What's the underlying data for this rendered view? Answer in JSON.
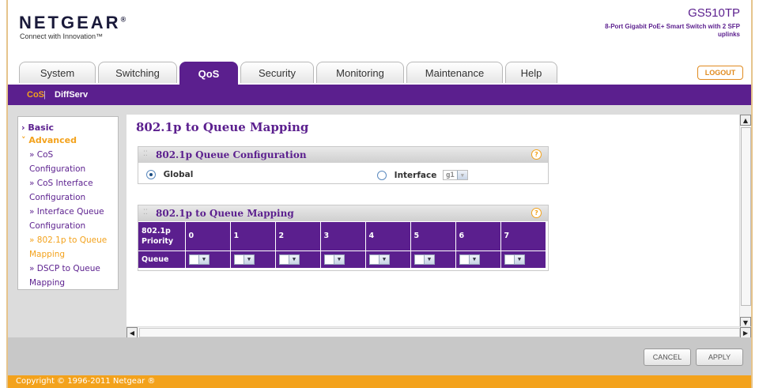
{
  "brand": {
    "logo_text": "NETGEAR",
    "logo_mark": "®",
    "tagline": "Connect with Innovation™"
  },
  "device": {
    "model": "GS510TP",
    "description": "8-Port Gigabit PoE+ Smart Switch with 2 SFP uplinks"
  },
  "tabs": [
    {
      "label": "System"
    },
    {
      "label": "Switching"
    },
    {
      "label": "QoS",
      "active": true
    },
    {
      "label": "Security"
    },
    {
      "label": "Monitoring"
    },
    {
      "label": "Maintenance"
    },
    {
      "label": "Help"
    }
  ],
  "logout_label": "LOGOUT",
  "subnav": {
    "cos": "CoS",
    "separator": "|",
    "diffserv": "DiffServ"
  },
  "sidebar": {
    "basic": "› Basic",
    "advanced": "˅ Advanced",
    "items": [
      {
        "label": "» CoS"
      },
      {
        "label": "Configuration"
      },
      {
        "label": "» CoS Interface"
      },
      {
        "label": "Configuration"
      },
      {
        "label": "» Interface Queue"
      },
      {
        "label": "Configuration"
      },
      {
        "label": "» 802.1p to Queue"
      },
      {
        "label": "Mapping"
      },
      {
        "label": "» DSCP to Queue"
      },
      {
        "label": "Mapping"
      }
    ]
  },
  "page_title": "802.1p to Queue Mapping",
  "config_panel": {
    "title": "802.1p Queue Configuration",
    "global_label": "Global",
    "interface_label": "Interface",
    "interface_value": "g1",
    "selected": "Global"
  },
  "mapping_panel": {
    "title": "802.1p to Queue Mapping",
    "priority_header_1": "802.1p",
    "priority_header_2": "Priority",
    "queue_header": "Queue",
    "priorities": [
      "0",
      "1",
      "2",
      "3",
      "4",
      "5",
      "6",
      "7"
    ],
    "queues": [
      "1",
      "0",
      "0",
      "1",
      "2",
      "2",
      "3",
      "3"
    ]
  },
  "buttons": {
    "cancel": "CANCEL",
    "apply": "APPLY"
  },
  "copyright": "Copyright © 1996-2011 Netgear ®",
  "colors": {
    "brand_purple": "#5b1f8e",
    "accent_orange": "#f3a21c"
  }
}
